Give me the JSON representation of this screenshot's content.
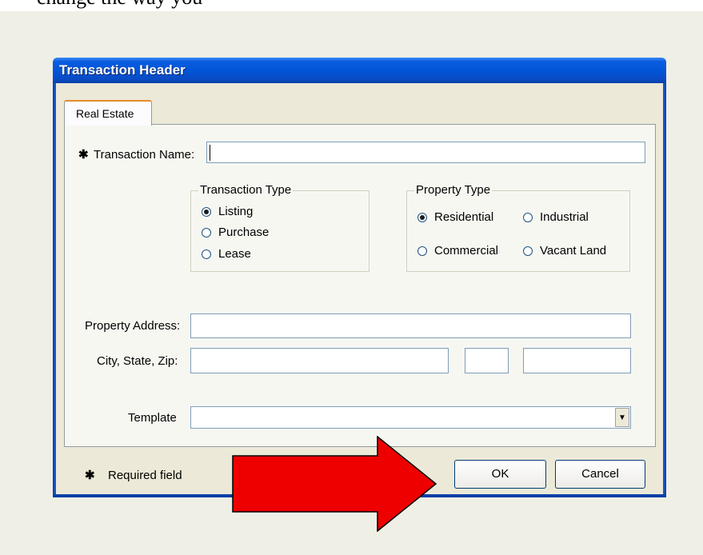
{
  "top_text": "change the way you",
  "dialog": {
    "title": "Transaction Header",
    "tab_label": "Real Estate",
    "transaction_name": {
      "label": "Transaction Name:",
      "value": ""
    },
    "transaction_type": {
      "legend": "Transaction Type",
      "options": [
        "Listing",
        "Purchase",
        "Lease"
      ],
      "selected": "Listing"
    },
    "property_type": {
      "legend": "Property Type",
      "options": [
        "Residential",
        "Industrial",
        "Commercial",
        "Vacant Land"
      ],
      "selected": "Residential"
    },
    "property_address": {
      "label": "Property Address:",
      "value": ""
    },
    "city_state_zip": {
      "label": "City, State, Zip:",
      "city": "",
      "state": "",
      "zip": ""
    },
    "template": {
      "label": "Template",
      "value": ""
    },
    "required_note": "Required field",
    "ok_label": "OK",
    "cancel_label": "Cancel"
  },
  "colors": {
    "titlebar": "#0254d6",
    "required_star": "#e21a1a",
    "arrow_fill": "#ee0000"
  }
}
